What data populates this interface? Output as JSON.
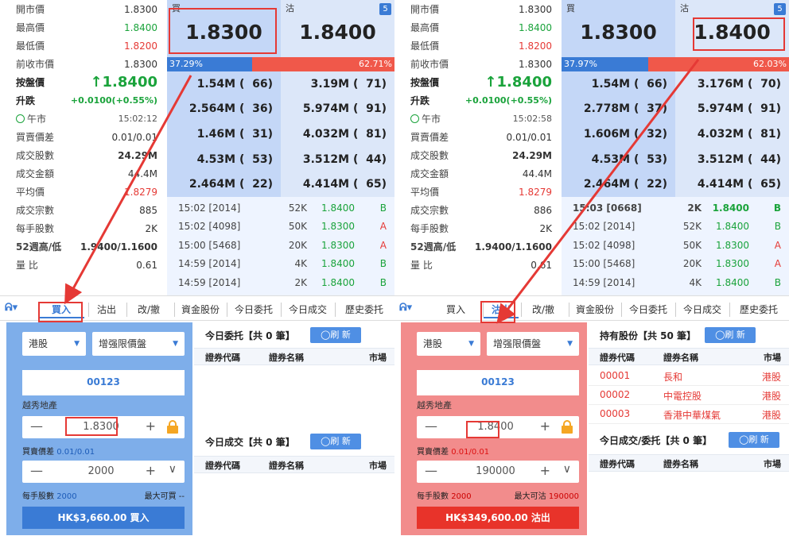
{
  "left": {
    "stats": [
      {
        "label": "開市價",
        "value": "1.8300",
        "cls": ""
      },
      {
        "label": "最高價",
        "value": "1.8400",
        "cls": "green"
      },
      {
        "label": "最低價",
        "value": "1.8200",
        "cls": "red"
      },
      {
        "label": "前收市價",
        "value": "1.8300",
        "cls": ""
      },
      {
        "label": "按盤價",
        "value": "↑1.8400",
        "cls": "big"
      },
      {
        "label": "升跌",
        "value": "+0.0100(+0.55%)",
        "cls": "chg"
      },
      {
        "label": "午市",
        "value": "15:02:12",
        "cls": "tm"
      },
      {
        "label": "買賣價差",
        "value": "0.01/0.01",
        "cls": ""
      },
      {
        "label": "成交股數",
        "value": "24.29M",
        "cls": "bold"
      },
      {
        "label": "成交金額",
        "value": "44.4M",
        "cls": ""
      },
      {
        "label": "平均價",
        "value": "1.8279",
        "cls": "red"
      },
      {
        "label": "成交宗數",
        "value": "885",
        "cls": ""
      },
      {
        "label": "每手股數",
        "value": "2K",
        "cls": ""
      },
      {
        "label": "52週高/低",
        "value": "1.9400/1.1600",
        "cls": "b52 bold"
      },
      {
        "label": "量 比",
        "value": "0.61",
        "cls": ""
      }
    ],
    "bid_label": "買",
    "ask_label": "沽",
    "bid_price": "1.8300",
    "ask_price": "1.8400",
    "badge": "5",
    "bid_pct": "37.29%",
    "ask_pct": "62.71%",
    "bid_frac": 0.3729,
    "bids": [
      "1.54M (  66)",
      "2.564M (  36)",
      "1.46M (  31)",
      "4.53M (  53)",
      "2.464M (  22)"
    ],
    "asks": [
      "3.19M (  71)",
      "5.974M (  91)",
      "4.032M (  81)",
      "3.512M (  44)",
      "4.414M (  65)"
    ],
    "trades": [
      {
        "t": "15:02 [2014]",
        "v": "52K",
        "p": "1.8400",
        "s": "B"
      },
      {
        "t": "15:02 [4098]",
        "v": "50K",
        "p": "1.8300",
        "s": "A"
      },
      {
        "t": "15:00 [5468]",
        "v": "20K",
        "p": "1.8300",
        "s": "A"
      },
      {
        "t": "14:59 [2014]",
        "v": "4K",
        "p": "1.8400",
        "s": "B"
      },
      {
        "t": "14:59 [2014]",
        "v": "2K",
        "p": "1.8400",
        "s": "B"
      }
    ],
    "tabs": [
      "買入",
      "沽出",
      "改/撤",
      "資金股份",
      "今日委托",
      "今日成交",
      "歷史委托"
    ],
    "active_tab": 0,
    "market": "港股",
    "order_type": "增强限價盤",
    "code": "00123",
    "stock_name": "越秀地產",
    "price": "1.8300",
    "spread_label": "買賣價差 ",
    "spread_val": "0.01/0.01",
    "qty": "2000",
    "lot_label": "每手股數 ",
    "lot_val": "2000",
    "max_label": "最大可買 ",
    "max_val": "--",
    "submit": "HK$3,660.00  買入",
    "top_head": "今日委托【共 0 筆】",
    "refresh": "◯刷 新",
    "bot_head": "今日成交【共 0 筆】",
    "cols": [
      "證券代碼",
      "證券名稱",
      "市場"
    ]
  },
  "right": {
    "stats": [
      {
        "label": "開市價",
        "value": "1.8300",
        "cls": ""
      },
      {
        "label": "最高價",
        "value": "1.8400",
        "cls": "green"
      },
      {
        "label": "最低價",
        "value": "1.8200",
        "cls": "red"
      },
      {
        "label": "前收市價",
        "value": "1.8300",
        "cls": ""
      },
      {
        "label": "按盤價",
        "value": "↑1.8400",
        "cls": "big"
      },
      {
        "label": "升跌",
        "value": "+0.0100(+0.55%)",
        "cls": "chg"
      },
      {
        "label": "午市",
        "value": "15:02:58",
        "cls": "tm"
      },
      {
        "label": "買賣價差",
        "value": "0.01/0.01",
        "cls": ""
      },
      {
        "label": "成交股數",
        "value": "24.29M",
        "cls": "bold"
      },
      {
        "label": "成交金額",
        "value": "44.4M",
        "cls": ""
      },
      {
        "label": "平均價",
        "value": "1.8279",
        "cls": "red"
      },
      {
        "label": "成交宗數",
        "value": "886",
        "cls": ""
      },
      {
        "label": "每手股數",
        "value": "2K",
        "cls": ""
      },
      {
        "label": "52週高/低",
        "value": "1.9400/1.1600",
        "cls": "b52 bold"
      },
      {
        "label": "量 比",
        "value": "0.61",
        "cls": ""
      }
    ],
    "bid_label": "買",
    "ask_label": "沽",
    "bid_price": "1.8300",
    "ask_price": "1.8400",
    "badge": "5",
    "bid_pct": "37.97%",
    "ask_pct": "62.03%",
    "bid_frac": 0.3797,
    "bids": [
      "1.54M (  66)",
      "2.778M (  37)",
      "1.606M (  32)",
      "4.53M (  53)",
      "2.464M (  22)"
    ],
    "asks": [
      "3.176M (  70)",
      "5.974M (  91)",
      "4.032M (  81)",
      "3.512M (  44)",
      "4.414M (  65)"
    ],
    "trades": [
      {
        "t": "15:03 [0668]",
        "v": "2K",
        "p": "1.8400",
        "s": "B",
        "bold": true
      },
      {
        "t": "15:02 [2014]",
        "v": "52K",
        "p": "1.8400",
        "s": "B"
      },
      {
        "t": "15:02 [4098]",
        "v": "50K",
        "p": "1.8300",
        "s": "A"
      },
      {
        "t": "15:00 [5468]",
        "v": "20K",
        "p": "1.8300",
        "s": "A"
      },
      {
        "t": "14:59 [2014]",
        "v": "4K",
        "p": "1.8400",
        "s": "B"
      }
    ],
    "tabs": [
      "買入",
      "沽出",
      "改/撤",
      "資金股份",
      "今日委托",
      "今日成交",
      "歷史委托"
    ],
    "active_tab": 1,
    "market": "港股",
    "order_type": "增强限價盤",
    "code": "00123",
    "stock_name": "越秀地產",
    "price": "1.8400",
    "spread_label": "買賣價差 ",
    "spread_val": "0.01/0.01",
    "qty": "190000",
    "lot_label": "每手股數 ",
    "lot_val": "2000",
    "max_label": "最大可沽 ",
    "max_val": "190000",
    "submit": "HK$349,600.00  沽出",
    "top_head": "持有股份【共 50 筆】",
    "refresh": "◯刷 新",
    "bot_head": "今日成交/委托【共 0 筆】",
    "cols": [
      "證券代碼",
      "證券名稱",
      "市場"
    ],
    "holdings": [
      {
        "code": "00001",
        "name": "長和",
        "mkt": "港股"
      },
      {
        "code": "00002",
        "name": "中電控股",
        "mkt": "港股"
      },
      {
        "code": "00003",
        "name": "香港中華煤氣",
        "mkt": "港股"
      }
    ]
  },
  "colors": {
    "bid_blue": "#3a7bd5",
    "ask_red": "#f0584a",
    "up_green": "#1aa33b",
    "highlight": "#e53935"
  }
}
